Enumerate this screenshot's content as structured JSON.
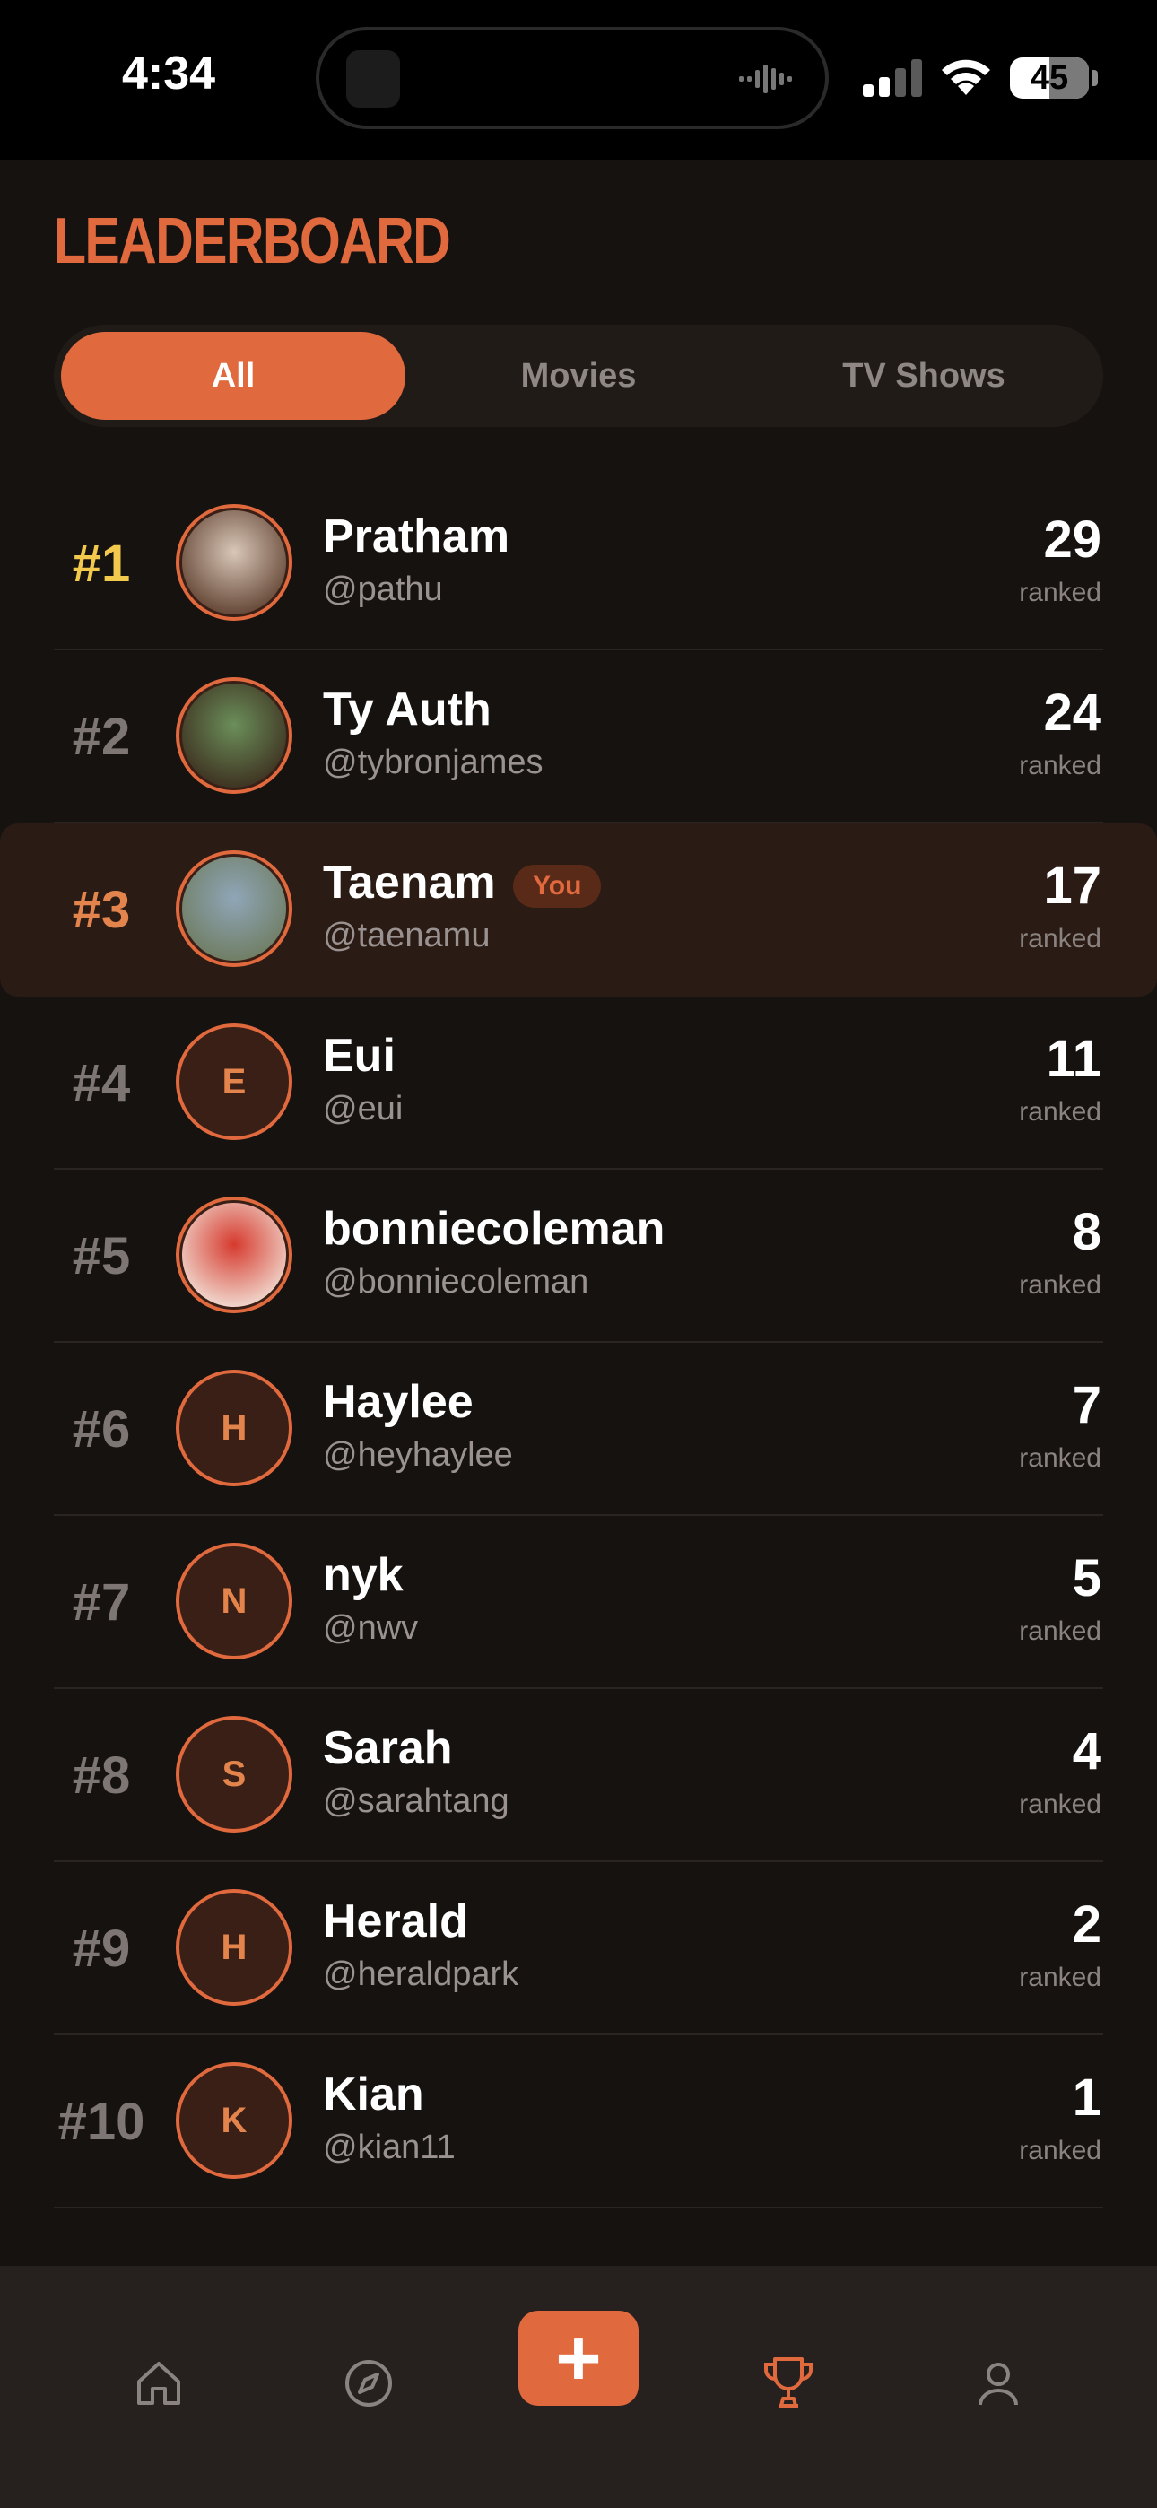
{
  "status": {
    "time": "4:34",
    "battery": "45"
  },
  "page": {
    "title": "LEADERBOARD"
  },
  "tabs": [
    {
      "label": "All",
      "active": true
    },
    {
      "label": "Movies",
      "active": false
    },
    {
      "label": "TV Shows",
      "active": false
    }
  ],
  "count_label": "ranked",
  "you_label": "You",
  "rows": [
    {
      "rank": "#1",
      "name": "Pratham",
      "handle": "@pathu",
      "count": "29",
      "initial": "",
      "photo": "photo-avatar"
    },
    {
      "rank": "#2",
      "name": "Ty Auth",
      "handle": "@tybronjames",
      "count": "24",
      "initial": "",
      "photo": "photo-avatar"
    },
    {
      "rank": "#3",
      "name": "Taenam",
      "handle": "@taenamu",
      "count": "17",
      "initial": "",
      "photo": "photo-avatar",
      "is_you": true
    },
    {
      "rank": "#4",
      "name": "Eui",
      "handle": "@eui",
      "count": "11",
      "initial": "E"
    },
    {
      "rank": "#5",
      "name": "bonniecoleman",
      "handle": "@bonniecoleman",
      "count": "8",
      "initial": "",
      "photo": "photo-avatar"
    },
    {
      "rank": "#6",
      "name": "Haylee",
      "handle": "@heyhaylee",
      "count": "7",
      "initial": "H"
    },
    {
      "rank": "#7",
      "name": "nyk",
      "handle": "@nwv",
      "count": "5",
      "initial": "N"
    },
    {
      "rank": "#8",
      "name": "Sarah",
      "handle": "@sarahtang",
      "count": "4",
      "initial": "S"
    },
    {
      "rank": "#9",
      "name": "Herald",
      "handle": "@heraldpark",
      "count": "2",
      "initial": "H"
    },
    {
      "rank": "#10",
      "name": "Kian",
      "handle": "@kian11",
      "count": "1",
      "initial": "K"
    }
  ],
  "tabbar": {
    "items": [
      "home-icon",
      "compass-icon",
      "add-icon",
      "trophy-icon",
      "profile-icon"
    ],
    "active": "trophy-icon",
    "add_label": "+"
  },
  "colors": {
    "accent": "#e0693e",
    "gold": "#f2c94c",
    "background": "#161210",
    "you_row": "#2a1b14"
  }
}
